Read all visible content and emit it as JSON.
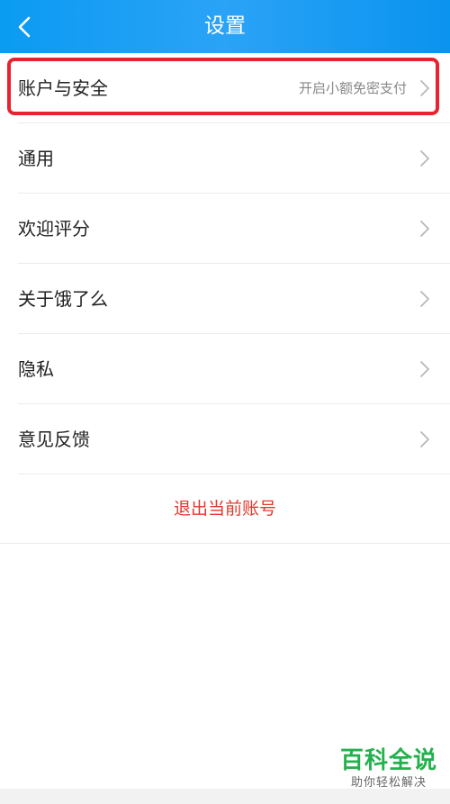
{
  "header": {
    "title": "设置",
    "back_icon": "chevron-left-icon"
  },
  "rows": [
    {
      "label": "账户与安全",
      "value": "开启小额免密支付"
    },
    {
      "label": "通用",
      "value": ""
    },
    {
      "label": "欢迎评分",
      "value": ""
    },
    {
      "label": "关于饿了么",
      "value": ""
    },
    {
      "label": "隐私",
      "value": ""
    },
    {
      "label": "意见反馈",
      "value": ""
    }
  ],
  "logout": {
    "label": "退出当前账号"
  },
  "watermark": {
    "main": "百科全说",
    "sub": "助你轻松解决"
  },
  "colors": {
    "header": "#1a9ff3",
    "logout": "#e0392c",
    "highlight": "#e8232f",
    "watermark": "#22b14c"
  }
}
